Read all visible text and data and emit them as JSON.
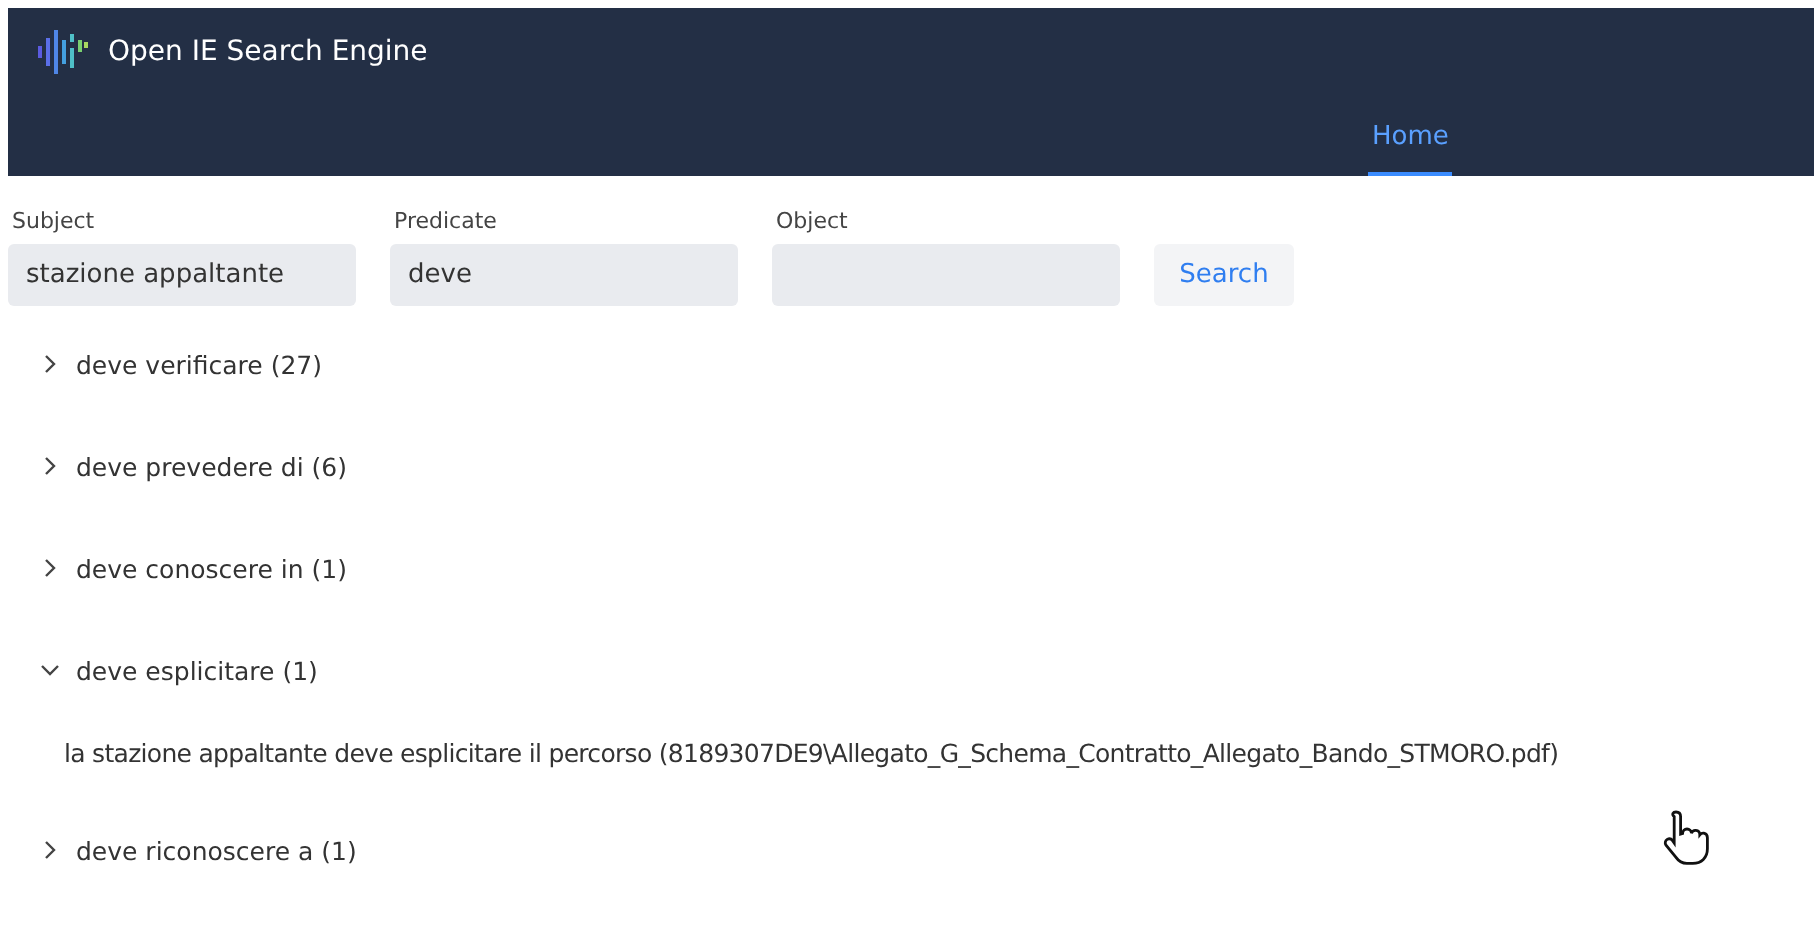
{
  "app": {
    "title": "Open IE Search Engine"
  },
  "nav": [
    {
      "label": "Home",
      "selected": true
    }
  ],
  "form": {
    "fields": [
      {
        "label": "Subject",
        "value": "stazione appaltante"
      },
      {
        "label": "Predicate",
        "value": "deve"
      },
      {
        "label": "Object"
      }
    ],
    "button": "Search"
  },
  "groups": [
    {
      "label": "deve verificare (27)",
      "expanded": false
    },
    {
      "label": "deve prevedere di (6)",
      "expanded": false
    },
    {
      "label": "deve conoscere in (1)",
      "expanded": false
    },
    {
      "label": "deve esplicitare (1)",
      "expanded": true,
      "results": [
        "la stazione appaltante deve esplicitare il percorso (8189307DE9\\Allegato_G_Schema_Contratto_Allegato_Bando_STMORO.pdf)"
      ]
    },
    {
      "label": "deve riconoscere a (1)",
      "expanded": false
    }
  ]
}
